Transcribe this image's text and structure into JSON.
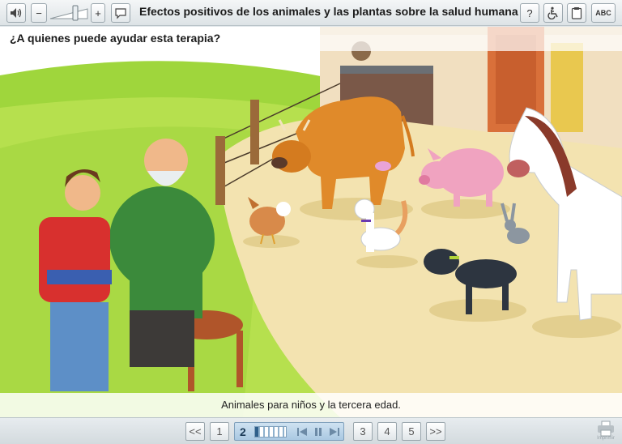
{
  "toolbar": {
    "title": "Efectos positivos de los animales y las plantas sobre la salud humana",
    "volume_level": 0.7,
    "zoom_out_label": "−",
    "zoom_in_label": "+",
    "help_label": "?",
    "abc_label": "ABC"
  },
  "scene": {
    "question": "¿A quienes puede ayudar esta terapia?",
    "caption": "Animales para niños y la tercera edad."
  },
  "pager": {
    "first_label": "<<",
    "pages_before": [
      "1"
    ],
    "current_page": "2",
    "progress": 0.1,
    "pages_after": [
      "3",
      "4",
      "5"
    ],
    "last_label": ">>",
    "print_label": "Imprimir"
  },
  "colors": {
    "grass": "#b6e04e",
    "path": "#f3e3b0",
    "sky": "#ffffff",
    "accent": "#2f5f8a"
  }
}
